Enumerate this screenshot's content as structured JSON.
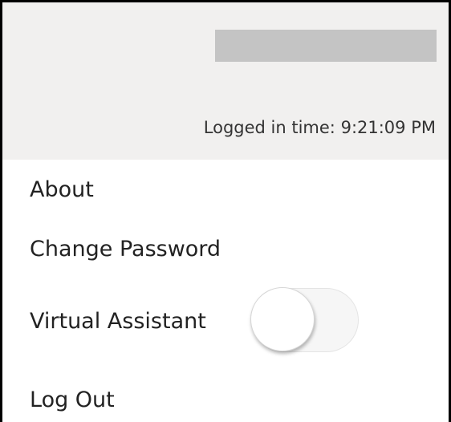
{
  "header": {
    "logged_label": "Logged in time:",
    "logged_time": "9:21:09 PM",
    "background": "#f1f0ef",
    "placeholder_color": "#c4c4c4"
  },
  "menu": {
    "about_label": "About",
    "change_password_label": "Change Password",
    "virtual_assistant_label": "Virtual Assistant",
    "virtual_assistant_enabled": false,
    "logout_label": "Log Out"
  }
}
